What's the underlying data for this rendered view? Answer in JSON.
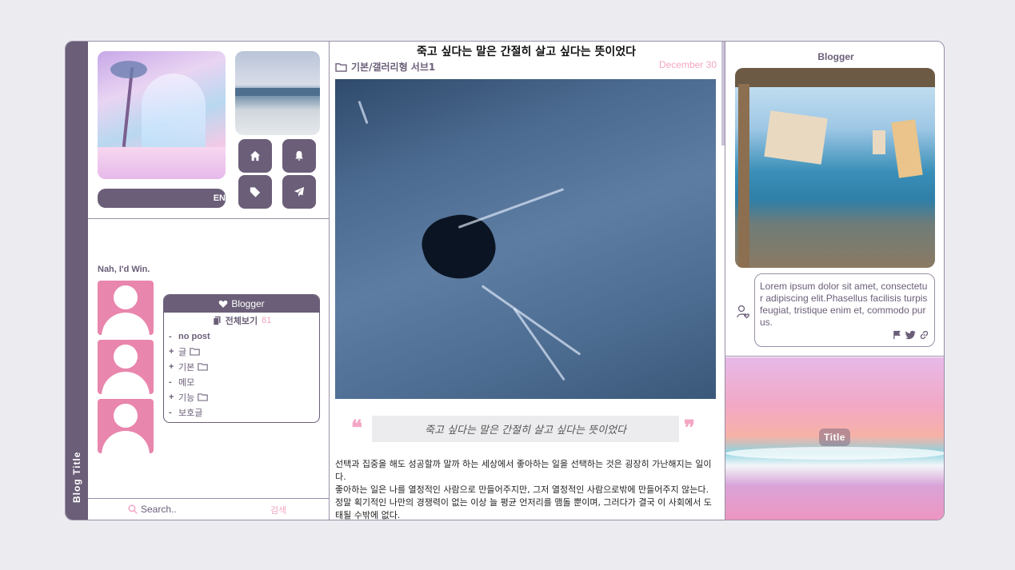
{
  "sidebar": {
    "blog_title": "Blog Title"
  },
  "profile": {
    "progress_label": "EN",
    "buttons": [
      {
        "name": "home-button",
        "icon": "home-icon"
      },
      {
        "name": "notifications-button",
        "icon": "bell-icon"
      },
      {
        "name": "tags-button",
        "icon": "tag-icon"
      },
      {
        "name": "guestbook-button",
        "icon": "paper-plane-icon"
      }
    ]
  },
  "widget": {
    "nah_label": "Nah, I'd Win."
  },
  "category": {
    "header": "Blogger",
    "all_label": "전체보기",
    "all_count": "81",
    "items": [
      {
        "toggle": "-",
        "label": "no post",
        "folder": false,
        "bold": true
      },
      {
        "toggle": "+",
        "label": "글",
        "folder": true
      },
      {
        "toggle": "+",
        "label": "기본",
        "folder": true
      },
      {
        "toggle": "-",
        "label": "메모",
        "folder": false
      },
      {
        "toggle": "+",
        "label": "기능",
        "folder": true
      },
      {
        "toggle": "-",
        "label": "보호글",
        "folder": false
      }
    ]
  },
  "search": {
    "placeholder": "Search..",
    "button_label": "검색"
  },
  "post": {
    "title": "죽고 싶다는 말은 간절히 살고 싶다는 뜻이었다",
    "category": "기본/갤러리형 서브1",
    "date": "December 30",
    "quote": "죽고 싶다는 말은 간절히 살고 싶다는 뜻이었다",
    "quote_open": "❝",
    "quote_close": "❞",
    "body": [
      "선택과 집중을 해도 성공할까 말까 하는 세상에서 좋아하는 일을 선택하는 것은 굉장히 가난해지는 일이다.",
      "좋아하는 일은 나를 열정적인 사람으로 만들어주지만, 그저 열정적인 사람으로밖에 만들어주지 않는다.",
      "정말 획기적인 나만의 경쟁력이 없는 이상 늘 평균 언저리를 맴돌 뿐이며, 그러다가 결국 이 사회에서 도태될 수밖에 없다."
    ]
  },
  "right_panel": {
    "blogger_label": "Blogger",
    "comment": "Lorem ipsum dolor sit amet, consectetur adipiscing elit.Phasellus facilisis turpis feugiat, tristique enim et, commodo purus.",
    "social_icons": [
      "flag-icon",
      "twitter-icon",
      "link-icon"
    ],
    "title_badge": "Title"
  },
  "colors": {
    "accent": "#6b5e78",
    "pink": "#f4a6c4",
    "avatar_bg": "#e986ad"
  }
}
